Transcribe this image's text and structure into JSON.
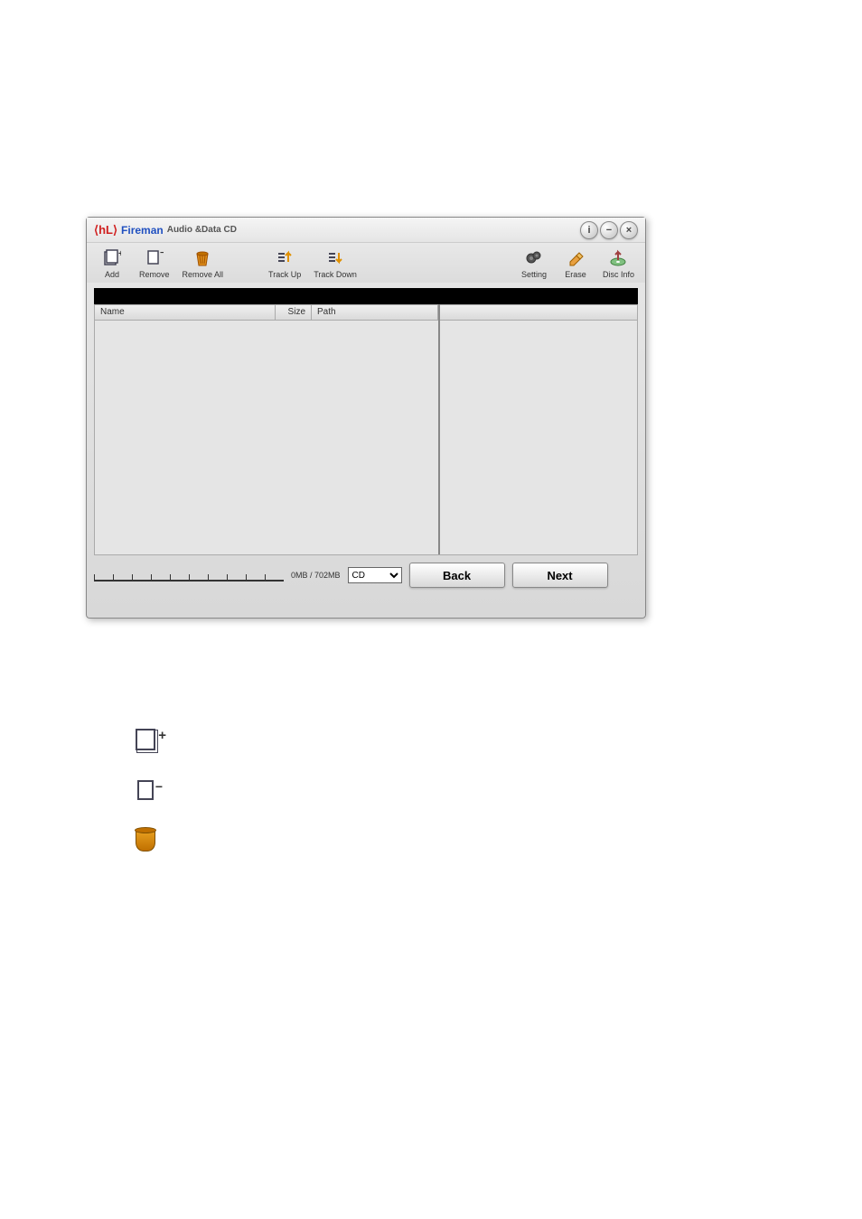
{
  "title": {
    "brand": "Fireman",
    "subtitle": "Audio &Data CD"
  },
  "toolbar": {
    "add": "Add",
    "remove": "Remove",
    "removeAll": "Remove All",
    "trackUp": "Track Up",
    "trackDown": "Track Down",
    "setting": "Setting",
    "erase": "Erase",
    "discInfo": "Disc Info"
  },
  "columns": {
    "name": "Name",
    "size": "Size",
    "path": "Path"
  },
  "footer": {
    "sizeText": "0MB / 702MB",
    "mediaSelected": "CD",
    "back": "Back",
    "next": "Next"
  }
}
